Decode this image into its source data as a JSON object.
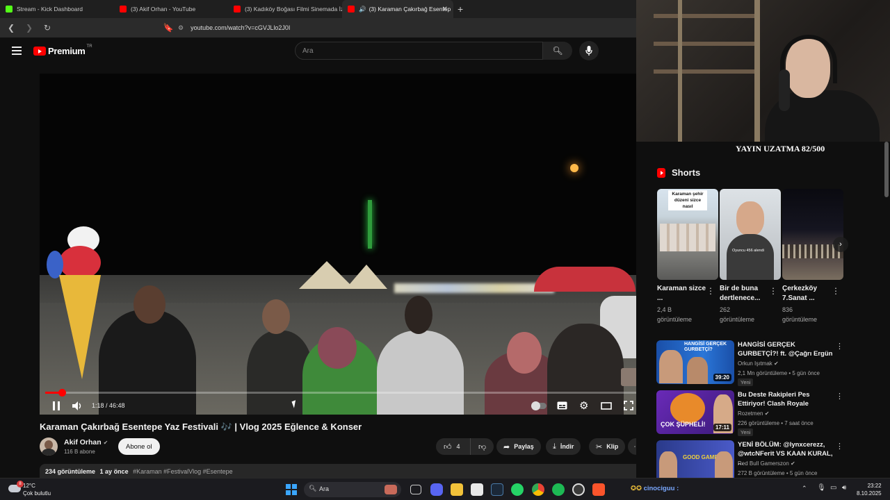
{
  "browser": {
    "tabs": [
      {
        "label": "Stream - Kick Dashboard",
        "color": "#53fc18"
      },
      {
        "label": "(3) Akif Orhan - YouTube",
        "color": "#ff0000"
      },
      {
        "label": "(3) Kadıköy Boğası Filmi Sinemada İzl",
        "color": "#ff0000"
      },
      {
        "label": "(3) Karaman Çakırbağ Esentep",
        "color": "#ff0000"
      }
    ],
    "url": "youtube.com/watch?v=cGVJLlo2J0I"
  },
  "youtube": {
    "logo": "Premium",
    "country": "TR",
    "search_placeholder": "Ara"
  },
  "player": {
    "time": "1:18 / 46:48",
    "progress": 0.028
  },
  "video": {
    "title": "Karaman Çakırbağ Esentepe Yaz Festivali 🎶 | Vlog 2025 Eğlence & Konser",
    "channel": "Akif Orhan",
    "subscribers": "116 B abone",
    "subscribe_label": "Abone ol",
    "likes": "4",
    "share_label": "Paylaş",
    "download_label": "İndir",
    "clip_label": "Klip",
    "views": "234 görüntüleme",
    "age": "1 ay önce",
    "tags": "#Karaman #FestivalVlog #Esentepe"
  },
  "overlay": {
    "banner": "YAYIN UZATMA 82/500"
  },
  "shorts": {
    "heading": "Shorts",
    "items": [
      {
        "caption": "Karaman şehir düzeni sizce nasıl",
        "title": "Karaman sizce ...",
        "views": "2,4 B",
        "views_label": "görüntüleme"
      },
      {
        "caption": "Oyuncu 456 alendi",
        "title": "Bir de buna dertlenece...",
        "views": "262",
        "views_label": "görüntüleme"
      },
      {
        "caption": "",
        "title": "Çerkezköy 7.Sanat ...",
        "views": "836",
        "views_label": "görüntüleme"
      }
    ]
  },
  "recommended": [
    {
      "title": "HANGİSİ GERÇEK GURBETÇİ?! ft. @Çağrı Ergün",
      "channel": "Orkun Işıtmak",
      "meta": "2,1 Mn görüntüleme • 5 gün önce",
      "badge": "Yeni",
      "duration": "39:20",
      "thumb_text": "HANGİSİ GERÇEK GURBETÇİ?"
    },
    {
      "title": "Bu Deste Rakipleri Pes Ettiriyor! Clash Royale",
      "channel": "Rozetmen",
      "meta": "226 görüntüleme • 7 saat önce",
      "badge": "Yeni",
      "duration": "17:11",
      "thumb_text": "ÇOK ŞÜPHELİ!"
    },
    {
      "title": "YENİ BÖLÜM: @lynxcerezz, @wtcNFerit VS KAAN KURAL, ...",
      "channel": "Red Bull Gamerszon",
      "meta": "272 B görüntüleme • 5 gün önce",
      "badge": "",
      "duration": "",
      "thumb_text": "GOOD GAME"
    }
  ],
  "taskbar": {
    "temp": "12°C",
    "weather": "Çok bulutlu",
    "search": "Ara",
    "notification_count": "8",
    "chat_user": "cinociguu :",
    "time": "23:22",
    "date": "8.10.2025"
  }
}
